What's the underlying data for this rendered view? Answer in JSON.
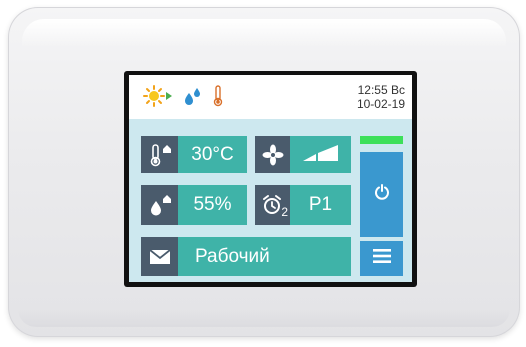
{
  "status_bar": {
    "icons": [
      "sun-icon",
      "water-drops-icon",
      "thermometer-icon"
    ],
    "time": "12:55 Вс",
    "date": "10-02-19"
  },
  "tiles": {
    "temperature": {
      "icon": "thermometer-home-icon",
      "value": "30°C"
    },
    "fan": {
      "icon": "fan-icon",
      "speed_icon": "signal-bars-icon"
    },
    "humidity": {
      "icon": "drop-home-icon",
      "value": "55%"
    },
    "schedule": {
      "icon": "alarm-clock-icon",
      "sub": "2",
      "value": "P1"
    },
    "mode": {
      "icon": "envelope-icon",
      "value": "Рабочий"
    }
  },
  "controls": {
    "power_icon": "power-icon",
    "menu_icon": "hamburger-menu-icon"
  },
  "colors": {
    "tile_icon_bg": "#4a5b6c",
    "tile_value_bg": "#3fb3a8",
    "button_bg": "#3a98cf",
    "status_indicator": "#3de05a",
    "screen_bg": "#cde8ef"
  }
}
